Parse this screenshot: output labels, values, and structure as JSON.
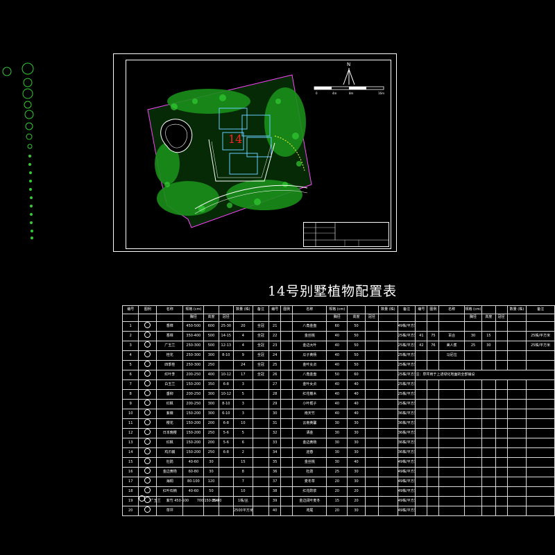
{
  "site_plan": {
    "label_number": "14",
    "north_label": "N",
    "scale_ticks": [
      "0",
      "4m",
      "8m",
      "16m"
    ]
  },
  "title": "14号别墅植物配置表",
  "table": {
    "header": {
      "no": "编号",
      "legend": "图例",
      "name": "名称",
      "spec": "规格 (cm)",
      "count": "数量 (株)",
      "remark": "备注",
      "sub": [
        "胸径",
        "高度",
        "冠径"
      ]
    },
    "left_rows": [
      [
        "1",
        "香樟",
        "450-500",
        "600",
        "25-30",
        "20",
        "全冠"
      ],
      [
        "2",
        "香樟",
        "350-400",
        "500",
        "14-15",
        "4",
        "全冠"
      ],
      [
        "3",
        "广玉兰",
        "250-300",
        "500",
        "12-13",
        "4",
        "全冠"
      ],
      [
        "4",
        "桂花",
        "250-300",
        "300",
        "8-10",
        "9",
        "全冠"
      ],
      [
        "5",
        "四季桂",
        "250-300",
        "250",
        "",
        "24",
        "全冠"
      ],
      [
        "6",
        "红叶李",
        "200-250",
        "400",
        "10-12",
        "17",
        "全冠"
      ],
      [
        "7",
        "白玉兰",
        "150-200",
        "350",
        "6-8",
        "3",
        ""
      ],
      [
        "8",
        "垂柳",
        "200-250",
        "300",
        "10-12",
        "5",
        ""
      ],
      [
        "9",
        "红枫",
        "200-250",
        "300",
        "8-10",
        "3",
        ""
      ],
      [
        "10",
        "紫薇",
        "150-200",
        "300",
        "6-10",
        "3",
        ""
      ],
      [
        "11",
        "樱花",
        "150-200",
        "200",
        "6-8",
        "10",
        ""
      ],
      [
        "12",
        "日本晚樱",
        "150-200",
        "250",
        "5-6",
        "5",
        ""
      ],
      [
        "13",
        "红枫",
        "150-200",
        "200",
        "5-6",
        "6",
        ""
      ],
      [
        "14",
        "鸡爪槭",
        "150-200",
        "250",
        "6-8",
        "2",
        ""
      ],
      [
        "15",
        "杜鹃",
        "40-60",
        "30",
        "",
        "15",
        ""
      ],
      [
        "16",
        "金边黄杨",
        "60-80",
        "30",
        "",
        "8",
        ""
      ],
      [
        "17",
        "海桐",
        "80-100",
        "120",
        "",
        "7",
        ""
      ],
      [
        "18",
        "红叶石楠",
        "40-60",
        "50",
        "",
        "10",
        ""
      ],
      [
        "19",
        "紫竹",
        "",
        "150-200",
        "",
        "1株/丛",
        ""
      ],
      [
        "20",
        "草坪",
        "",
        "",
        "",
        "2500平方米",
        ""
      ]
    ],
    "middle_rows": [
      [
        "21",
        "八角金盘",
        "60",
        "50",
        "",
        "",
        "49株/平方米"
      ],
      [
        "22",
        "金丝桃",
        "40",
        "50",
        "",
        "",
        "25株/平方米"
      ],
      [
        "23",
        "金边大叶",
        "40",
        "50",
        "",
        "",
        "25株/平方米"
      ],
      [
        "24",
        "瓜子黄杨",
        "40",
        "50",
        "",
        "",
        "25株/平方米"
      ],
      [
        "25",
        "金叶女贞",
        "40",
        "50",
        "",
        "",
        "25株/平方米"
      ],
      [
        "26",
        "八角金盘",
        "50",
        "60",
        "",
        "",
        "25株/平方米"
      ],
      [
        "27",
        "金叶女贞",
        "40",
        "40",
        "",
        "",
        "25株/平方米"
      ],
      [
        "28",
        "红花檵木",
        "40",
        "40",
        "",
        "",
        "25株/平方米"
      ],
      [
        "29",
        "小叶栀子",
        "40",
        "40",
        "",
        "",
        "25株/平方米"
      ],
      [
        "30",
        "南天竹",
        "40",
        "40",
        "",
        "",
        "36株/平方米"
      ],
      [
        "31",
        "云南黄馨",
        "30",
        "30",
        "",
        "",
        "36株/平方米"
      ],
      [
        "32",
        "洒金",
        "30",
        "30",
        "",
        "",
        "36株/平方米"
      ],
      [
        "33",
        "金边黄杨",
        "30",
        "30",
        "",
        "",
        "36株/平方米"
      ],
      [
        "34",
        "迎春",
        "30",
        "30",
        "",
        "",
        "36株/平方米"
      ],
      [
        "35",
        "金丝桃",
        "30",
        "40",
        "",
        "",
        "49株/平方米"
      ],
      [
        "36",
        "杜鹃",
        "25",
        "30",
        "",
        "",
        "49株/平方米"
      ],
      [
        "37",
        "麦冬草",
        "20",
        "30",
        "",
        "",
        "49株/平方米"
      ],
      [
        "38",
        "红花酢浆",
        "20",
        "20",
        "",
        "",
        "49株/平方米"
      ],
      [
        "39",
        "金边阔叶麦冬",
        "15",
        "20",
        "",
        "",
        "49株/平方米"
      ],
      [
        "40",
        "鸢尾",
        "20",
        "30",
        "",
        "",
        "49株/平方米"
      ]
    ],
    "right_rows": [
      [
        "",
        "",
        "",
        "",
        "",
        "",
        "",
        "",
        ""
      ],
      [
        "41",
        "75",
        "百合",
        "30",
        "15",
        "",
        "",
        "25株/平方米"
      ],
      [
        "42",
        "76",
        "美人蕉",
        "25",
        "30",
        "",
        "",
        "25株/平方米"
      ],
      [
        "",
        "",
        "马尼拉",
        "",
        "",
        "",
        "",
        ""
      ]
    ],
    "note": "注：草坪用于上述绿化地面的全部铺设",
    "extra_row": [
      "21",
      "广玉兰",
      "450-500",
      "700",
      "35-40"
    ]
  },
  "colors": {
    "background": "#000000",
    "green": "#33cc33",
    "magenta": "#ff44ff",
    "yellow": "#ffff44",
    "cyan": "#66ccff",
    "red": "#ff2222"
  }
}
